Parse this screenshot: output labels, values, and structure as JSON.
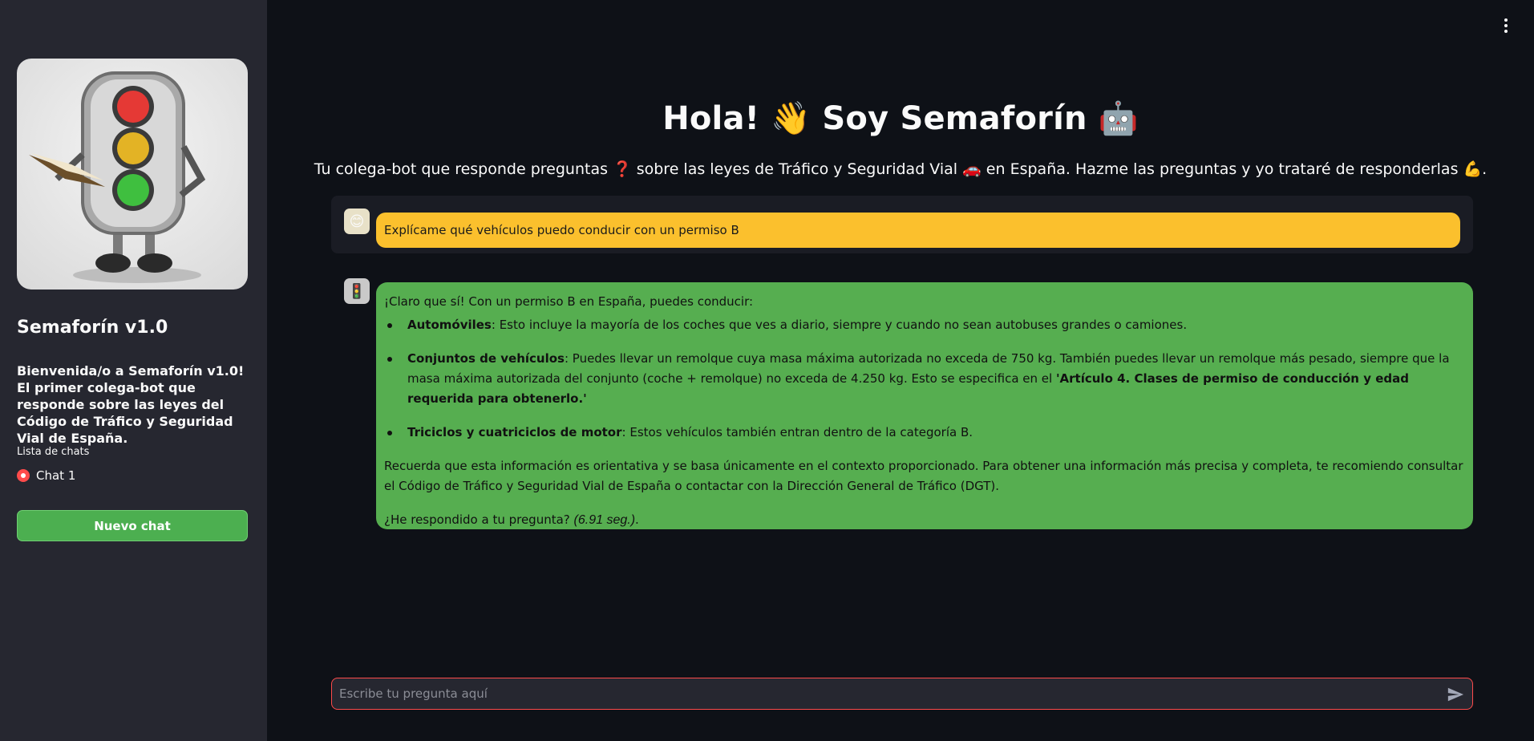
{
  "sidebar": {
    "title": "Semaforín v1.0",
    "welcome": "Bienvenida/o a Semaforín v1.0! El primer colega-bot que responde sobre las leyes del Código de Tráfico y Seguridad Vial de España.",
    "list_label": "Lista de chats",
    "chats": [
      "Chat 1"
    ],
    "new_chat_label": "Nuevo chat"
  },
  "main": {
    "title": "Hola! 👋 Soy Semaforín 🤖",
    "subtitle": "Tu colega-bot que responde preguntas ❓ sobre las leyes de Tráfico y Seguridad Vial 🚗 en España. Hazme las preguntas y yo trataré de responderlas 💪."
  },
  "messages": {
    "user": "Explícame qué vehículos puedo conducir con un permiso B",
    "bot": {
      "intro": "¡Claro que sí! Con un permiso B en España, puedes conducir:",
      "items": [
        {
          "bold": "Automóviles",
          "text": ": Esto incluye la mayoría de los coches que ves a diario, siempre y cuando no sean autobuses grandes o camiones."
        },
        {
          "bold": "Conjuntos de vehículos",
          "text": ": Puedes llevar un remolque cuya masa máxima autorizada no exceda de 750 kg. También puedes llevar un remolque más pesado, siempre que la masa máxima autorizada del conjunto (coche + remolque) no exceda de 4.250 kg. Esto se especifica en el ",
          "bold2": "'Artículo 4. Clases de permiso de conducción y edad requerida para obtenerlo.'"
        },
        {
          "bold": "Triciclos y cuatriciclos de motor",
          "text": ": Estos vehículos también entran dentro de la categoría B."
        }
      ],
      "note": "Recuerda que esta información es orientativa y se basa únicamente en el contexto proporcionado. Para obtener una información más precisa y completa, te recomiendo consultar el Código de Tráfico y Seguridad Vial de España o contactar con la Dirección General de Tráfico (DGT).",
      "question": "¿He respondido a tu pregunta? ",
      "time": "(6.91 seg.)",
      "time_suffix": "."
    }
  },
  "input": {
    "placeholder": "Escribe tu pregunta aquí"
  },
  "icons": {
    "menu": "kebab-menu-icon",
    "send": "send-icon",
    "user_avatar": "user-face-icon",
    "bot_avatar": "traffic-light-robot-icon"
  }
}
